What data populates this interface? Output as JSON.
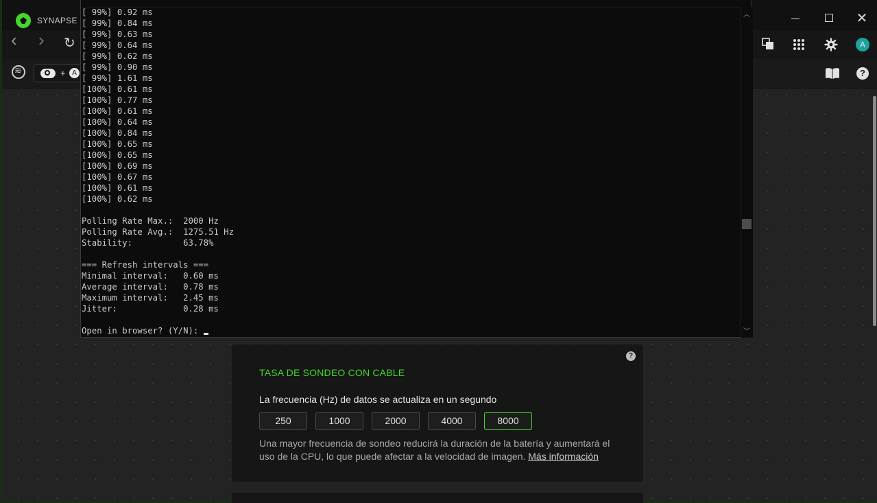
{
  "synapse": {
    "app_title": "SYNAPSE",
    "window_controls": {
      "close_glyph": "✕"
    },
    "nav": {
      "back_glyph": "‹",
      "forward_glyph": "›",
      "refresh_glyph": "↻"
    },
    "toolbar": {
      "plus": "+",
      "key_a": "A"
    },
    "icons": {
      "avatar": "A",
      "avatar_color": "#1ba39c",
      "accent": "#44d62c"
    }
  },
  "card": {
    "title": "TASA DE SONDEO CON CABLE",
    "help": "?",
    "subtitle": "La frecuencia (Hz) de datos se actualiza en un segundo",
    "rates": [
      "250",
      "1000",
      "2000",
      "4000",
      "8000"
    ],
    "selected_rate": "8000",
    "note": "Una mayor frecuencia de sondeo reducirá la duración de la batería y aumentará el uso de la CPU, lo que puede afectar a la velocidad de imagen.",
    "more_link": "Más información"
  },
  "console": {
    "lines": [
      "[ 99%] 0.92 ms",
      "[ 99%] 0.84 ms",
      "[ 99%] 0.63 ms",
      "[ 99%] 0.64 ms",
      "[ 99%] 0.62 ms",
      "[ 99%] 0.90 ms",
      "[ 99%] 1.61 ms",
      "[100%] 0.61 ms",
      "[100%] 0.77 ms",
      "[100%] 0.61 ms",
      "[100%] 0.64 ms",
      "[100%] 0.84 ms",
      "[100%] 0.65 ms",
      "[100%] 0.65 ms",
      "[100%] 0.69 ms",
      "[100%] 0.67 ms",
      "[100%] 0.61 ms",
      "[100%] 0.62 ms",
      "",
      "Polling Rate Max.:  2000 Hz",
      "Polling Rate Avg.:  1275.51 Hz",
      "Stability:          63.78%",
      "",
      "=== Refresh intervals ===",
      "Minimal interval:   0.60 ms",
      "Average interval:   0.78 ms",
      "Maximum interval:   2.45 ms",
      "Jitter:             0.28 ms",
      ""
    ],
    "prompt": "Open in browser? (Y/N): "
  }
}
